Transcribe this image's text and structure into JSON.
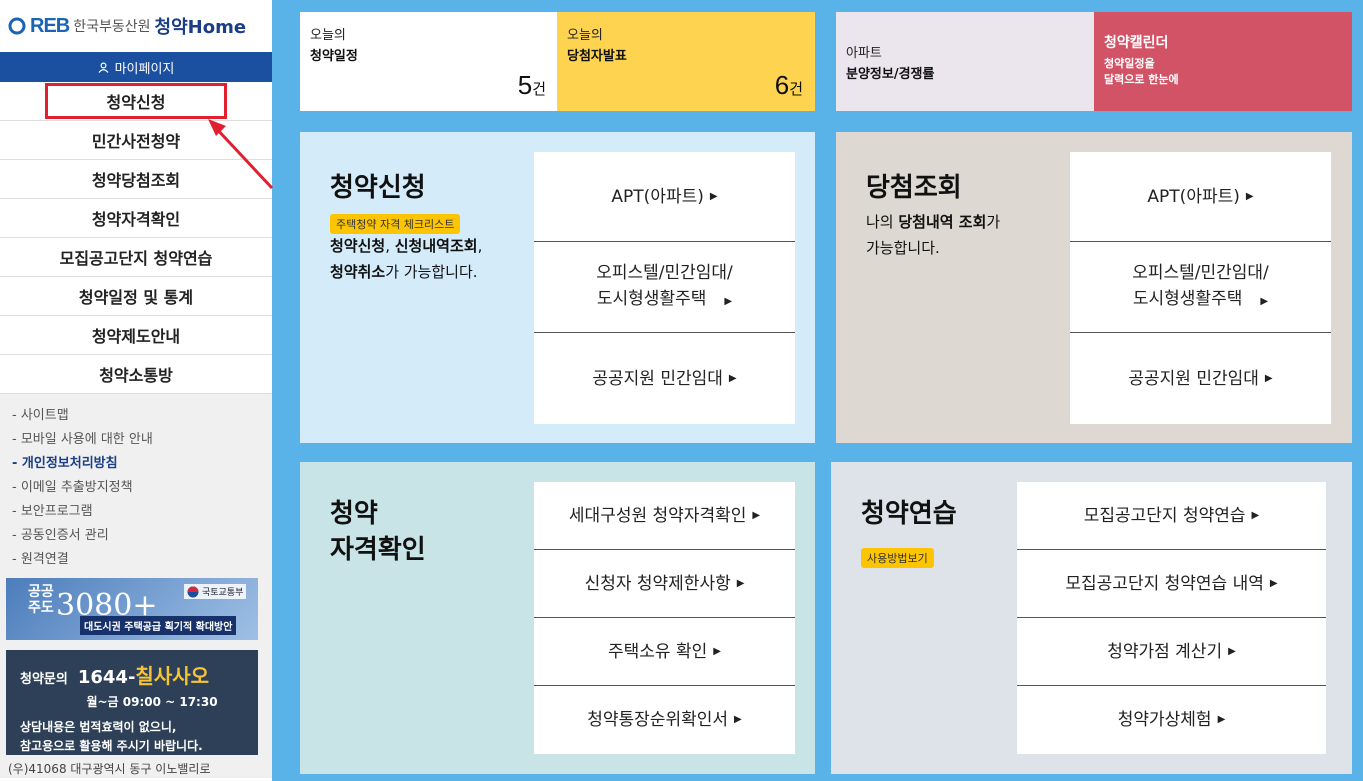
{
  "logo": {
    "brand": "REB",
    "org": "한국부동산원",
    "home": "청약Home"
  },
  "sidebar": {
    "mypage": "마이페이지",
    "menu": [
      "청약신청",
      "민간사전청약",
      "청약당첨조회",
      "청약자격확인",
      "모집공고단지 청약연습",
      "청약일정 및 통계",
      "청약제도안내",
      "청약소통방"
    ],
    "links": [
      "- 사이트맵",
      "- 모바일 사용에 대한 안내",
      "- 개인정보처리방침",
      "- 이메일 추출방지정책",
      "- 보안프로그램",
      "- 공동인증서 관리",
      "- 원격연결"
    ],
    "banner": {
      "t1": "공공\n주도",
      "t2": "3080+",
      "ministry": "국토교통부",
      "caption": "대도시권 주택공급 획기적 확대방안"
    },
    "call": {
      "label": "청약문의",
      "number_prefix": "1644-",
      "number_highlight": "칠사사오",
      "hours": "월~금 09:00 ~ 17:30",
      "note1": "상담내용은 법적효력이 없으니,",
      "note2": "참고용으로 활용해 주시기 바랍니다."
    },
    "address": "(우)41068 대구광역시 동구 이노밸리로"
  },
  "top": {
    "schedule": {
      "l1": "오늘의",
      "l2": "청약일정",
      "count": "5",
      "unit": "건"
    },
    "winners": {
      "l1": "오늘의",
      "l2": "당첨자발표",
      "count": "6",
      "unit": "건"
    },
    "apt": {
      "l1": "아파트",
      "l2": "분양정보/경쟁률"
    },
    "calendar": {
      "title": "청약캘린더",
      "sub1": "청약일정을",
      "sub2": "달력으로 한눈에"
    }
  },
  "panels": {
    "apply": {
      "title": "청약신청",
      "badge": "주택청약 자격 체크리스트",
      "desc_b1": "청약신청",
      "desc_t1": ", ",
      "desc_b2": "신청내역조회",
      "desc_t2": ",",
      "desc_b3": "청약취소",
      "desc_t3": "가 가능합니다.",
      "items": [
        "APT(아파트)",
        "오피스텔/민간임대/",
        "도시형생활주택",
        "공공지원 민간임대"
      ]
    },
    "winner": {
      "title": "당첨조회",
      "desc_t1": "나의 ",
      "desc_b1": "당첨내역 조회",
      "desc_t2": "가",
      "desc_t3": "가능합니다.",
      "items": [
        "APT(아파트)",
        "오피스텔/민간임대/",
        "도시형생활주택",
        "공공지원 민간임대"
      ]
    },
    "qualify": {
      "title1": "청약",
      "title2": "자격확인",
      "items": [
        "세대구성원 청약자격확인",
        "신청자 청약제한사항",
        "주택소유 확인",
        "청약통장순위확인서"
      ]
    },
    "practice": {
      "title": "청약연습",
      "badge": "사용방법보기",
      "items": [
        "모집공고단지 청약연습",
        "모집공고단지 청약연습 내역",
        "청약가점 계산기",
        "청약가상체험"
      ]
    }
  },
  "colors": {
    "bg": "#5ab3e8",
    "nav": "#1b4fa0",
    "highlight": "#e0202f",
    "yellow": "#fdd34f",
    "red": "#d35366"
  }
}
